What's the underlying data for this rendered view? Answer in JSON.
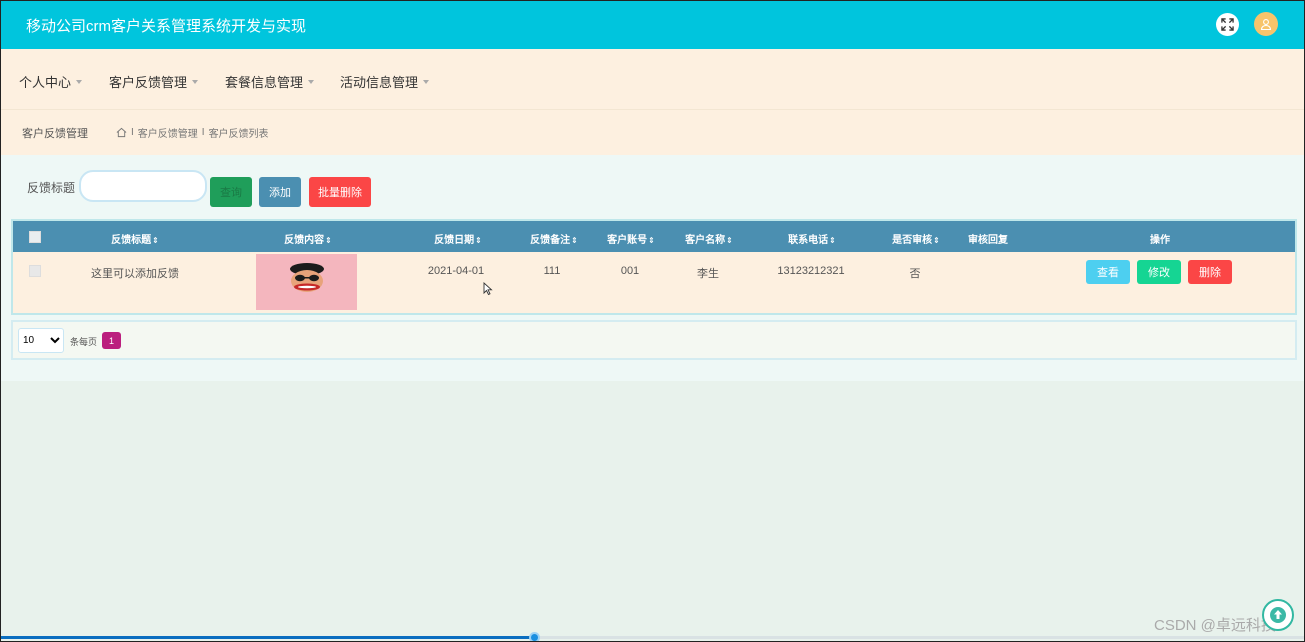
{
  "header": {
    "app_title": "移动公司crm客户关系管理系统开发与实现",
    "fullscreen_icon": "fullscreen-icon",
    "avatar_icon": "user-avatar-icon"
  },
  "nav": {
    "items": [
      {
        "label": "个人中心"
      },
      {
        "label": "客户反馈管理"
      },
      {
        "label": "套餐信息管理"
      },
      {
        "label": "活动信息管理"
      }
    ]
  },
  "breadcrumb": {
    "title": "客户反馈管理",
    "home_icon": "home-icon",
    "path": [
      "客户反馈管理",
      "客户反馈列表"
    ],
    "separator": "I"
  },
  "search": {
    "label": "反馈标题",
    "value": "",
    "search_button": "查询",
    "add_button": "添加",
    "batch_delete_button": "批量删除"
  },
  "table": {
    "columns": [
      {
        "label": "反馈标题",
        "sortable": true
      },
      {
        "label": "反馈内容",
        "sortable": true
      },
      {
        "label": "反馈日期",
        "sortable": true
      },
      {
        "label": "反馈备注",
        "sortable": true
      },
      {
        "label": "客户账号",
        "sortable": true
      },
      {
        "label": "客户名称",
        "sortable": true
      },
      {
        "label": "联系电话",
        "sortable": true
      },
      {
        "label": "是否审核",
        "sortable": true
      },
      {
        "label": "审核回复",
        "sortable": false
      },
      {
        "label": "操作",
        "sortable": false
      }
    ],
    "sort_glyph": "⇕",
    "rows": [
      {
        "title": "这里可以添加反馈",
        "date": "2021-04-01",
        "remark": "111",
        "account": "001",
        "name": "李生",
        "phone": "13123212321",
        "audited": "否",
        "reply": "",
        "actions": {
          "view": "查看",
          "edit": "修改",
          "delete": "删除"
        }
      }
    ]
  },
  "pagination": {
    "page_size": "10",
    "page_size_options": [
      "10"
    ],
    "per_page_text": "条每页",
    "current_page": "1"
  },
  "footer": {
    "watermark": "CSDN @卓远科技",
    "scroll_top_icon": "arrow-up-icon",
    "progress": 0.41
  },
  "colors": {
    "header": "#00c5dd",
    "nav_bg": "#fdf0e0",
    "table_header": "#4b8fb1",
    "danger": "#fb4646",
    "success": "#15d593",
    "info": "#4dcff0",
    "page_active": "#bb1f7e"
  }
}
